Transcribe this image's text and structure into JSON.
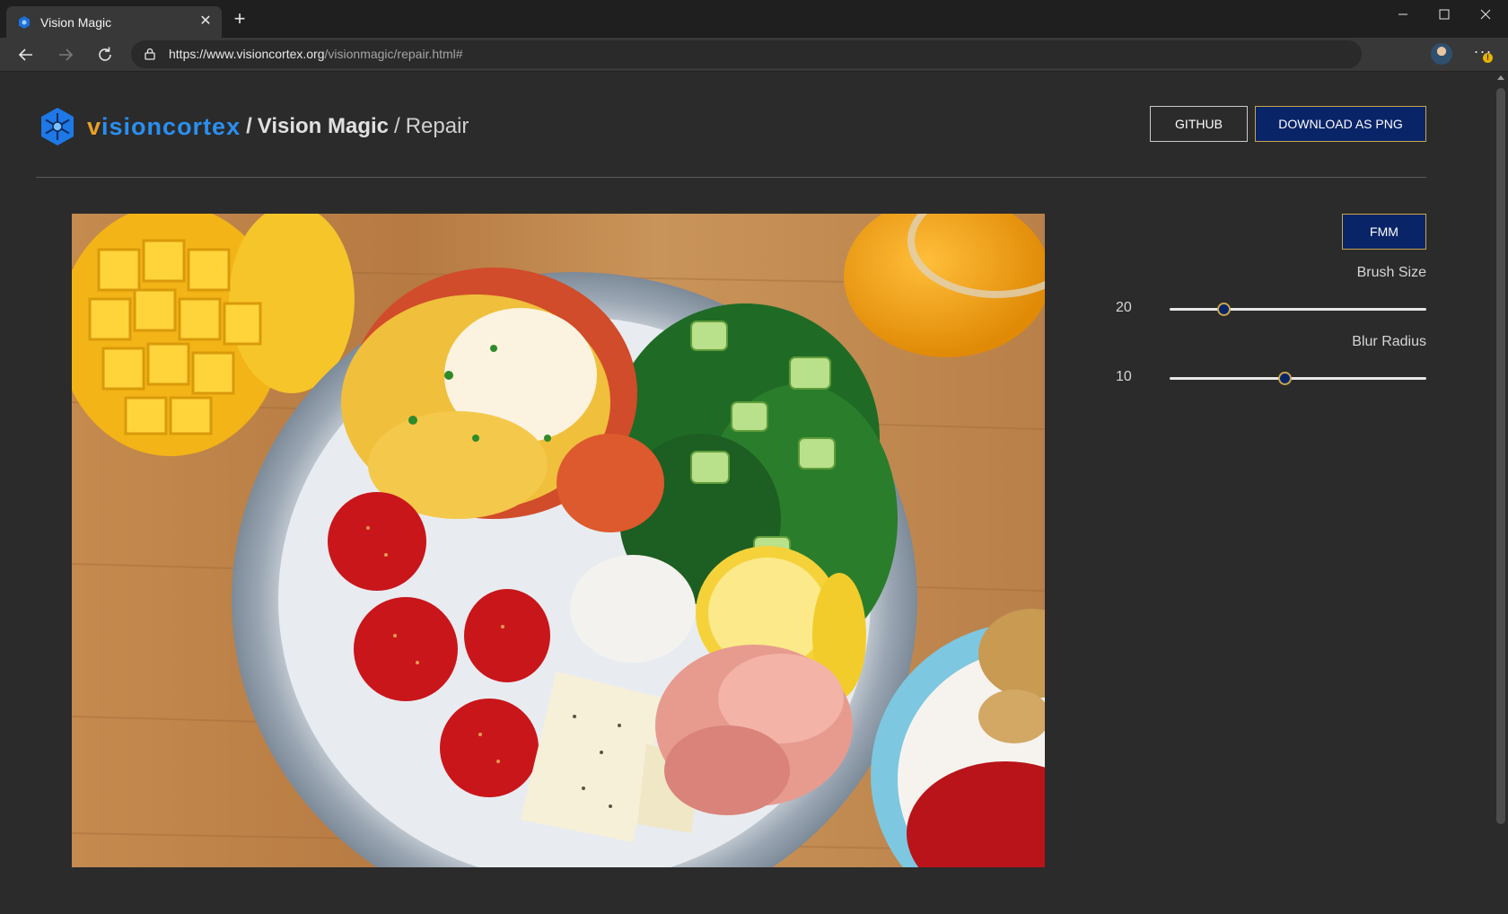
{
  "browser": {
    "tab_title": "Vision Magic",
    "new_tab_label": "+",
    "close_label": "✕",
    "url_host": "https://www.visioncortex.org",
    "url_path": "/visionmagic/repair.html#",
    "menu_label": "···",
    "menu_badge": "!"
  },
  "header": {
    "brand_v": "v",
    "brand_vision_rest": "ision",
    "brand_cortex": "cortex",
    "sep1": "/",
    "app_name": "Vision Magic",
    "sep2": "/",
    "page_name": "Repair",
    "github_label": "GITHUB",
    "download_label": "DOWNLOAD AS PNG"
  },
  "panel": {
    "algorithm_label": "FMM",
    "brush_size": {
      "label": "Brush Size",
      "value": "20",
      "fraction": 0.21
    },
    "blur_radius": {
      "label": "Blur Radius",
      "value": "10",
      "fraction": 0.45
    }
  },
  "colors": {
    "accent_blue": "#0a2468",
    "accent_gold": "#c9a64a",
    "brand_blue": "#2a8ff0",
    "brand_orange": "#e8a028",
    "background": "#2b2b2b"
  }
}
